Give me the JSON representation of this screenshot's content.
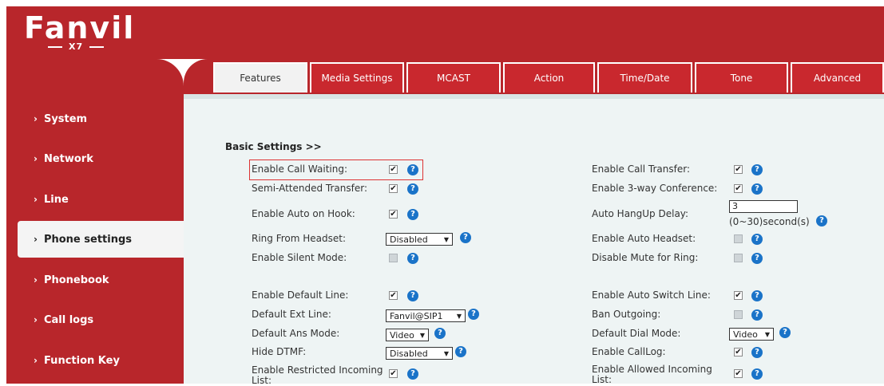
{
  "brand": {
    "logo": "Fanvil",
    "model": "X7"
  },
  "sidebar": {
    "items": [
      {
        "label": "System"
      },
      {
        "label": "Network"
      },
      {
        "label": "Line"
      },
      {
        "label": "Phone settings"
      },
      {
        "label": "Phonebook"
      },
      {
        "label": "Call logs"
      },
      {
        "label": "Function Key"
      }
    ],
    "active": "Phone settings"
  },
  "tabs": [
    {
      "label": "Features"
    },
    {
      "label": "Media Settings"
    },
    {
      "label": "MCAST"
    },
    {
      "label": "Action"
    },
    {
      "label": "Time/Date"
    },
    {
      "label": "Tone"
    },
    {
      "label": "Advanced"
    }
  ],
  "active_tab": "Features",
  "section_title": "Basic Settings >>",
  "left_fields": {
    "call_waiting": {
      "label": "Enable Call Waiting:",
      "checked": true
    },
    "semi_attended": {
      "label": "Semi-Attended Transfer:",
      "checked": true
    },
    "auto_on_hook": {
      "label": "Enable Auto on Hook:",
      "checked": true
    },
    "ring_headset": {
      "label": "Ring From Headset:",
      "value": "Disabled"
    },
    "silent_mode": {
      "label": "Enable Silent Mode:",
      "checked": false
    },
    "default_line": {
      "label": "Enable Default Line:",
      "checked": true
    },
    "default_ext": {
      "label": "Default Ext Line:",
      "value": "Fanvil@SIP1"
    },
    "ans_mode": {
      "label": "Default Ans Mode:",
      "value": "Video"
    },
    "hide_dtmf": {
      "label": "Hide DTMF:",
      "value": "Disabled"
    },
    "restricted_incoming": {
      "label_line1": "Enable Restricted Incoming",
      "label_line2": "List:",
      "checked": true
    }
  },
  "right_fields": {
    "call_transfer": {
      "label": "Enable Call Transfer:",
      "checked": true
    },
    "three_way": {
      "label": "Enable 3-way Conference:",
      "checked": true
    },
    "hangup_delay": {
      "label": "Auto HangUp Delay:",
      "value": "3",
      "hint": "(0~30)second(s)"
    },
    "auto_headset": {
      "label": "Enable Auto Headset:",
      "checked": false
    },
    "mute_ring": {
      "label": "Disable Mute for Ring:",
      "checked": false
    },
    "auto_switch": {
      "label": "Enable Auto Switch Line:",
      "checked": true
    },
    "ban_outgoing": {
      "label": "Ban Outgoing:",
      "checked": false
    },
    "dial_mode": {
      "label": "Default Dial Mode:",
      "value": "Video"
    },
    "calllog": {
      "label": "Enable CallLog:",
      "checked": true
    },
    "allowed_incoming": {
      "label_line1": "Enable Allowed Incoming",
      "label_line2": "List:",
      "checked": true
    }
  },
  "colors": {
    "brand_red": "#b8262b",
    "help_blue": "#1a73c8",
    "panel_bg": "#eef4f4"
  }
}
